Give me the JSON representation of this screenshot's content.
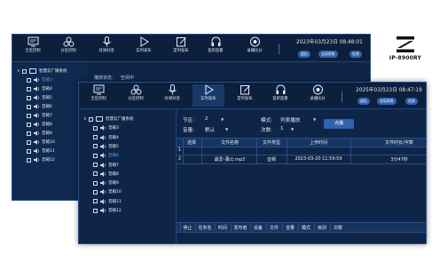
{
  "logo": {
    "model": "IP-8900RY"
  },
  "back_window": {
    "toolbar": [
      {
        "icon": "monitor-icon",
        "label": "全区控制"
      },
      {
        "icon": "partition-icon",
        "label": "分区控制"
      },
      {
        "icon": "mic-icon",
        "label": "对讲对话"
      },
      {
        "icon": "play-icon",
        "label": "实时发布"
      },
      {
        "icon": "edit-icon",
        "label": "定时发布"
      },
      {
        "icon": "headset-icon",
        "label": "监听监看"
      },
      {
        "icon": "record-icon",
        "label": "录播比分"
      }
    ],
    "datetime": "2023年03月23日  08:48:01",
    "pills": [
      "退出",
      "全局系统",
      "在线"
    ],
    "status_label": "播放状态：",
    "status_value": "空闲中",
    "tree": {
      "root": "智慧云广播系统",
      "items": [
        "音箱3",
        "音箱4",
        "音箱5",
        "音箱6",
        "音箱7",
        "音箱8",
        "音箱9",
        "音箱10",
        "音箱11",
        "音箱12"
      ]
    }
  },
  "front_window": {
    "toolbar": [
      {
        "icon": "monitor-icon",
        "label": "全区控制"
      },
      {
        "icon": "partition-icon",
        "label": "分区控制"
      },
      {
        "icon": "mic-icon",
        "label": "对讲对话"
      },
      {
        "icon": "play-icon",
        "label": "实时发布"
      },
      {
        "icon": "edit-icon",
        "label": "定时发布"
      },
      {
        "icon": "headset-icon",
        "label": "监听监看"
      },
      {
        "icon": "record-icon",
        "label": "录播比分"
      }
    ],
    "active_tool": "实时发布",
    "datetime": "2025年03月23日  08:47:19",
    "pills": [
      "退出",
      "全局系统",
      "在线"
    ],
    "tree": {
      "root": "智慧云广播系统",
      "items": [
        "音箱3",
        "音箱4",
        "音箱5",
        "音箱6",
        "音箱7",
        "音箱8",
        "音箱9",
        "音箱10",
        "音箱11",
        "音箱12"
      ]
    },
    "controls": {
      "zone_label": "节区:",
      "zone_value": "2",
      "mode_label": "模式:",
      "mode_value": "列表播放",
      "volume_label": "音量:",
      "volume_value": "默认",
      "count_label": "次数:",
      "count_value": "1",
      "confirm_label": "点播"
    },
    "file_table": {
      "headers": [
        "选择",
        "文件名称",
        "文件类型",
        "上传时间",
        "文件时长/字数"
      ],
      "rows": [
        {
          "index": "1",
          "select": "",
          "name": "",
          "type": "",
          "time": "",
          "duration": ""
        },
        {
          "index": "2",
          "select": "",
          "name": "最爱-蒲公.mp3",
          "type": "音频",
          "time": "2023-03-20 11:59:59",
          "duration": "3分47秒"
        }
      ]
    },
    "task_table": {
      "headers": [
        "停止",
        "任务名",
        "时间",
        "发布者",
        "设备",
        "文件",
        "音量",
        "模式",
        "级别",
        "次数"
      ]
    }
  },
  "colors": {
    "window_bg": "#0f2547",
    "toolbar_bg": "#0c1f3c",
    "accent": "#2e63b0",
    "selected_text": "#3fa1ff"
  }
}
